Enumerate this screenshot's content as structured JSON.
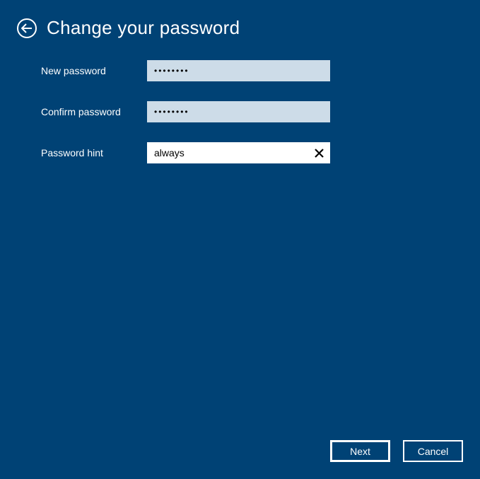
{
  "header": {
    "title": "Change your password"
  },
  "fields": {
    "new_password": {
      "label": "New password",
      "value": "••••••••"
    },
    "confirm_password": {
      "label": "Confirm password",
      "value": "••••••••"
    },
    "password_hint": {
      "label": "Password hint",
      "value": "always"
    }
  },
  "buttons": {
    "next": "Next",
    "cancel": "Cancel"
  }
}
